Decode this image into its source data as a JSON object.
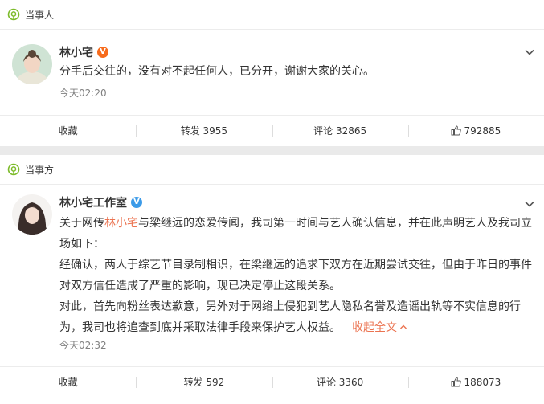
{
  "posts": [
    {
      "section_label": "当事人",
      "author": "林小宅",
      "badge": "V",
      "badge_color": "#f76b1c",
      "lines": [
        "分手后交往的，没有对不起任何人，已分开，谢谢大家的关心。"
      ],
      "time": "今天02:20",
      "actions": {
        "favorite": "收藏",
        "repost": "转发 3955",
        "comment": "评论 32865",
        "like": "792885"
      }
    },
    {
      "section_label": "当事方",
      "author": "林小宅工作室",
      "badge": "V",
      "badge_color": "#3c9be8",
      "text_part1": "关于网传",
      "text_mention": "林小宅",
      "text_part2": "与梁继远的恋爱传闻，我司第一时间与艺人确认信息，并在此声明艺人及我司立场如下：",
      "para2": "经确认，两人于综艺节目录制相识，在梁继远的追求下双方在近期尝试交往，但由于昨日的事件对双方信任造成了严重的影响，现已决定停止这段关系。",
      "para3": "对此，首先向粉丝表达歉意，另外对于网络上侵犯到艺人隐私名誉及造谣出轨等不实信息的行为，我司也将追查到底并采取法律手段来保护艺人权益。",
      "collapse_label": "收起全文",
      "time": "今天02:32",
      "actions": {
        "favorite": "收藏",
        "repost": "转发 592",
        "comment": "评论 3360",
        "like": "188073"
      }
    }
  ],
  "colors": {
    "accent": "#eb7350",
    "tag_green": "#7dbb2b",
    "secondary_text": "#808080"
  }
}
